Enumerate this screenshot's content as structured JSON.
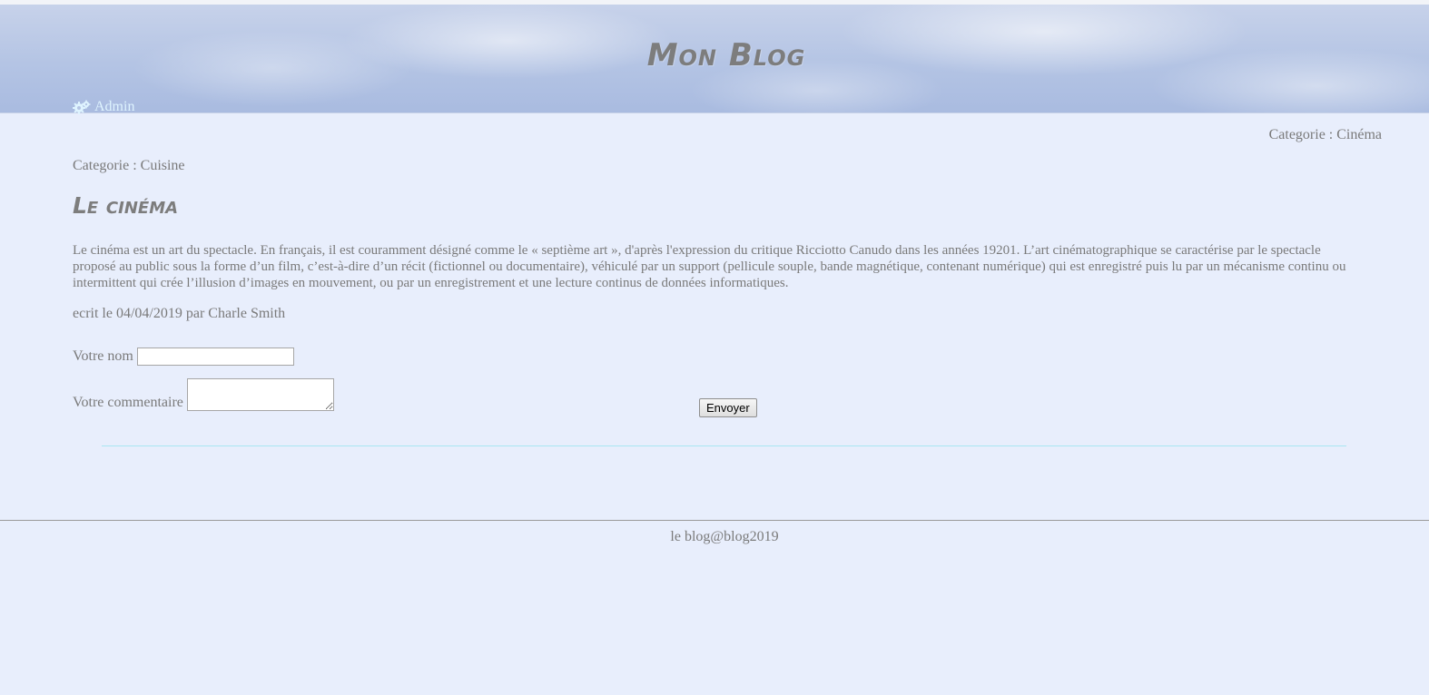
{
  "header": {
    "title": "Mon Blog",
    "admin_label": "Admin",
    "admin_icon": "gears-icon"
  },
  "categories": {
    "right": "Categorie : Cinéma",
    "left": "Categorie : Cuisine"
  },
  "article": {
    "title": "Le cinéma",
    "body": "Le cinéma est un art du spectacle. En français, il est couramment désigné comme le « septième art », d'après l'expression du critique Ricciotto Canudo dans les années 19201. L’art cinématographique se caractérise par le spectacle proposé au public sous la forme d’un film, c’est-à-dire d’un récit (fictionnel ou documentaire), véhiculé par un support (pellicule souple, bande magnétique, contenant numérique) qui est enregistré puis lu par un mécanisme continu ou intermittent qui crée l’illusion d’images en mouvement, ou par un enregistrement et une lecture continus de données informatiques.",
    "byline": "ecrit le 04/04/2019 par Charle Smith"
  },
  "comment_form": {
    "name_label": "Votre nom",
    "name_value": "",
    "comment_label": "Votre commentaire",
    "comment_value": "",
    "submit_label": "Envoyer"
  },
  "footer": {
    "text": "le blog@blog2019"
  },
  "colors": {
    "background": "#e8eefc",
    "text": "#7a7a7a",
    "admin_link": "#dff4ff",
    "divider": "#a9e7f2"
  }
}
